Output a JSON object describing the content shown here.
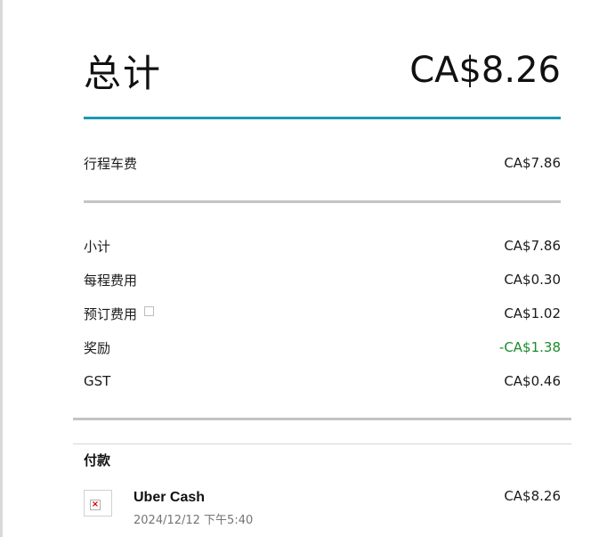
{
  "total": {
    "label": "总计",
    "amount": "CA$8.26"
  },
  "fare": {
    "label": "行程车费",
    "amount": "CA$7.86"
  },
  "breakdown": [
    {
      "label": "小计",
      "amount": "CA$7.86",
      "negative": false,
      "has_info": false
    },
    {
      "label": "每程费用",
      "amount": "CA$0.30",
      "negative": false,
      "has_info": false
    },
    {
      "label": "预订费用",
      "amount": "CA$1.02",
      "negative": false,
      "has_info": true
    },
    {
      "label": "奖励",
      "amount": "-CA$1.38",
      "negative": true,
      "has_info": false
    },
    {
      "label": "GST",
      "amount": "CA$0.46",
      "negative": false,
      "has_info": false
    }
  ],
  "payment": {
    "heading": "付款",
    "method": "Uber Cash",
    "datetime": "2024/12/12 下午5:40",
    "amount": "CA$8.26"
  },
  "colors": {
    "accent": "#1a9ab1",
    "negative": "#1c8b2c",
    "divider": "#c4c4c4"
  }
}
